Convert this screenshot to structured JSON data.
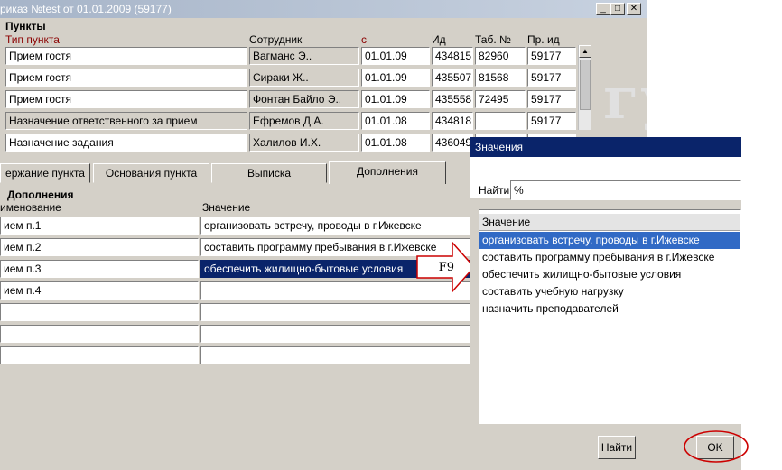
{
  "window": {
    "title": "риказ №test от 01.01.2009 (59177)",
    "buttons": {
      "minimize": "_",
      "maximize": "□",
      "close": "✕"
    },
    "watermark": "гу"
  },
  "items_section": {
    "title": "Пункты",
    "columns": [
      "Тип пункта",
      "Сотрудник",
      "с",
      "Ид",
      "Таб. №",
      "Пр. ид"
    ],
    "rows": [
      [
        "Прием гостя",
        "Вагманс Э..",
        "01.01.09",
        "434815",
        "82960",
        "59177"
      ],
      [
        "Прием гостя",
        "Сираки Ж..",
        "01.01.09",
        "435507",
        "81568",
        "59177"
      ],
      [
        "Прием гостя",
        "Фонтан Байло Э..",
        "01.01.09",
        "435558",
        "72495",
        "59177"
      ],
      [
        "Назначение ответственного за прием",
        "Ефремов Д.А.",
        "01.01.08",
        "434818",
        "",
        "59177"
      ],
      [
        "Назначение задания",
        "Халилов И.Х.",
        "01.01.08",
        "436049",
        "",
        ""
      ]
    ]
  },
  "tabs": [
    "ержание пункта",
    "Основания пункта",
    "Выписка",
    "Дополнения"
  ],
  "additions": {
    "title": "Дополнения",
    "columns": [
      "именование",
      "Значение"
    ],
    "rows": [
      [
        "ием п.1",
        "организовать встречу, проводы в г.Ижевске"
      ],
      [
        "ием п.2",
        "составить программу пребывания в г.Ижевске"
      ],
      [
        "ием п.3",
        "обеспечить жилищно-бытовые условия"
      ],
      [
        "ием п.4",
        ""
      ],
      [
        "",
        ""
      ],
      [
        "",
        ""
      ],
      [
        "",
        ""
      ]
    ]
  },
  "hint_key": "F9",
  "dialog": {
    "title": "Значения",
    "find_label": "Найти",
    "find_value": "%",
    "list_header": "Значение",
    "items": [
      "организовать встречу, проводы в г.Ижевске",
      "составить программу пребывания в г.Ижевске",
      "обеспечить жилищно-бытовые условия",
      "составить учебную нагрузку",
      "назначить преподавателей"
    ],
    "selected_index": 0,
    "find_button": "Найти",
    "ok_button": "OK"
  },
  "colors": {
    "title_gradient_start": "#a6b4c8",
    "dialog_title": "#0a246a",
    "selection": "#316ac5",
    "header_red": "#8b0000",
    "highlight_ring": "#cc0000"
  }
}
